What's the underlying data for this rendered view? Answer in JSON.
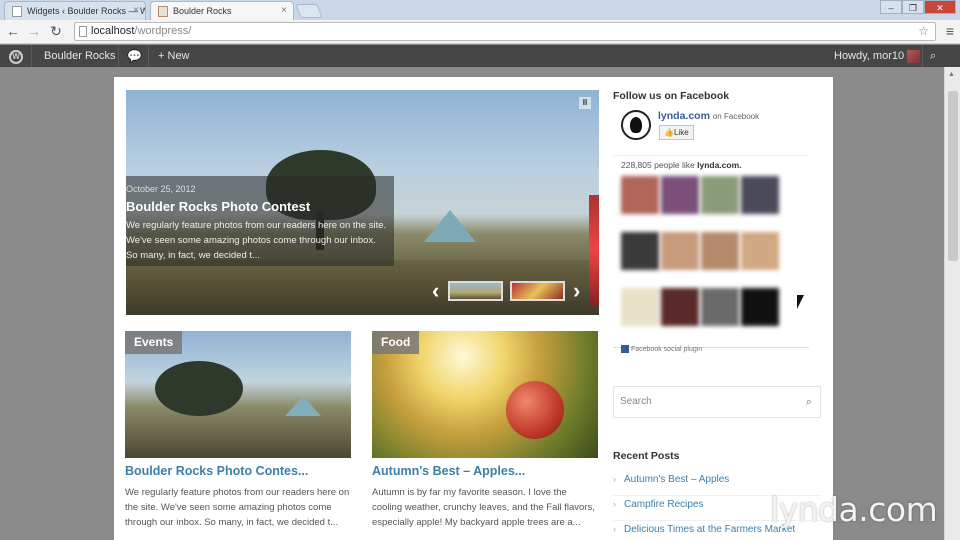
{
  "browser": {
    "tabs": [
      {
        "label": "Widgets ‹ Boulder Rocks — W",
        "active": false
      },
      {
        "label": "Boulder Rocks",
        "active": true
      }
    ],
    "url_host": "localhost",
    "url_path": "/wordpress/"
  },
  "adminbar": {
    "site_name": "Boulder Rocks",
    "new_label": "New",
    "howdy": "Howdy, mor10"
  },
  "slider": {
    "date": "October 25, 2012",
    "title": "Boulder Rocks Photo Contest",
    "excerpt": "We regularly feature photos from our readers here on the site. We've seen some amazing photos come through our inbox. So many, in fact, we decided t..."
  },
  "posts": [
    {
      "category": "Events",
      "title": "Boulder Rocks Photo Contes...",
      "excerpt": "We regularly feature photos from our readers here on the site. We've seen some amazing photos come through our inbox. So many, in fact, we decided t..."
    },
    {
      "category": "Food",
      "title": "Autumn's Best – Apples...",
      "excerpt": "Autumn is by far my favorite season. I love the cooling weather, crunchy leaves, and the Fall flavors, especially apple! My backyard apple trees are a..."
    }
  ],
  "sidebar": {
    "facebook_title": "Follow us on Facebook",
    "fb_page_name": "lynda.com",
    "fb_on": "on Facebook",
    "fb_like": "Like",
    "fb_count_prefix": "228,805 people like",
    "fb_count_name": "lynda.com.",
    "fb_plugin": "Facebook social plugin",
    "search_placeholder": "Search",
    "recent_posts_title": "Recent Posts",
    "recent_posts": [
      "Autumn's Best – Apples",
      "Campfire Recipes",
      "Delicious Times at the Farmers Market"
    ]
  },
  "watermark": "lynda.com",
  "colors": {
    "accent_link": "#3d7fa7",
    "admin_bar": "#464646"
  }
}
